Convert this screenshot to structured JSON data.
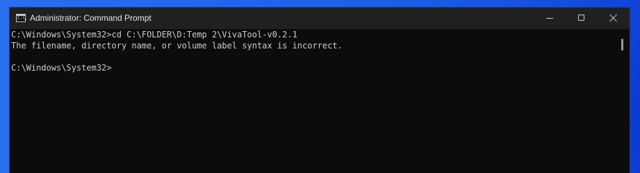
{
  "window": {
    "title": "Administrator: Command Prompt",
    "app_icon_glyph": "C:\\.",
    "controls": {
      "minimize": "minimize-icon",
      "maximize": "maximize-icon",
      "close": "close-icon"
    }
  },
  "console": {
    "lines": [
      "C:\\Windows\\System32>cd C:\\FOLDER\\D:Temp 2\\VivaTool-v0.2.1",
      "The filename, directory name, or volume label syntax is incorrect.",
      "",
      "C:\\Windows\\System32>"
    ]
  },
  "colors": {
    "titlebar": "#202020",
    "console_bg": "#0c0c0c",
    "console_text": "#cccccc",
    "desktop": "#1e5fe6"
  }
}
